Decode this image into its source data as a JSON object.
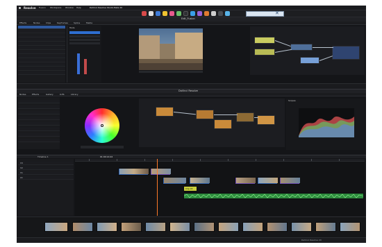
{
  "menubar": {
    "app_name": "Resolve",
    "items": [
      "Fusion",
      "Workspace",
      "Window",
      "Help"
    ],
    "title": "DaVinci Resolve Studio Beta 20",
    "workspaces": [
      "Cut",
      "Edit",
      "Fusion",
      "Color",
      "Fairlight",
      "Deliver"
    ]
  },
  "fusion": {
    "title": "Edit_Fusion",
    "media_tabs": [
      "Effects",
      "Nodes",
      "Clips",
      "Keyframes",
      "Spline",
      "Media"
    ],
    "tools_label": "Tools"
  },
  "color": {
    "title": "DaVinci Resolve",
    "tabs": [
      "Nodes",
      "Effects",
      "Gallery",
      "LUTs",
      "Library"
    ],
    "scopes_label": "Scopes",
    "colorwheel_label": "Primaries",
    "lift_label": "Lift",
    "gamma_label": "Gamma",
    "gain_label": "Gain"
  },
  "timeline": {
    "title": "Timeline 1",
    "timecode": "01:00:14:22",
    "tracks": [
      {
        "name": "V3",
        "label": "Video 3"
      },
      {
        "name": "V2",
        "label": "Video 2"
      },
      {
        "name": "V1",
        "label": "Video 1"
      },
      {
        "name": "A1",
        "label": "Audio 1"
      }
    ],
    "clip_label": "Clip 03"
  },
  "thumbnails_strip": {
    "count": 13
  },
  "status": {
    "label": "DaVinci Resolve 20"
  },
  "colors": {
    "bg": "#141518",
    "panel": "#1e1f23",
    "accent": "#3a6fd8",
    "clip_blue": "#2f5fa8",
    "clip_green": "#2e8b3e",
    "clip_purple": "#6a4bb0",
    "playhead": "#ff7a2a"
  },
  "icons": [
    "apple-icon",
    "dock-icons",
    "chevron-icon",
    "gear-icon"
  ]
}
